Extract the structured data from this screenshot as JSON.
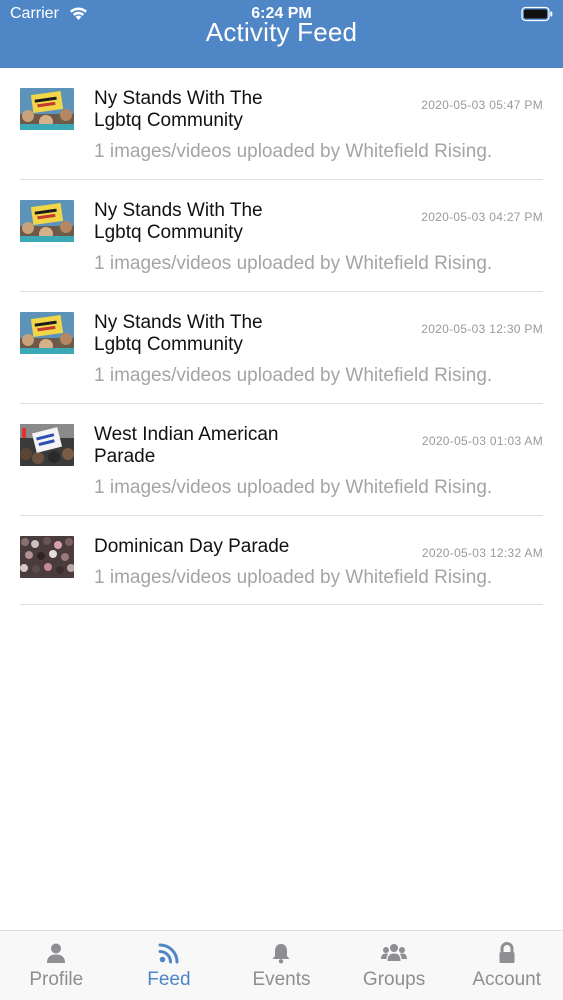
{
  "status_bar": {
    "carrier": "Carrier",
    "time": "6:24 PM"
  },
  "header": {
    "title": "Activity Feed",
    "background_color": "#4f86c6"
  },
  "feed": {
    "items": [
      {
        "title": "Ny Stands With The Lgbtq Community",
        "timestamp": "2020-05-03 05:47 PM",
        "subtitle": "1 images/videos uploaded by Whitefield Rising.",
        "thumbnail": "protest-sign-image"
      },
      {
        "title": "Ny Stands With The Lgbtq Community",
        "timestamp": "2020-05-03 04:27 PM",
        "subtitle": "1 images/videos uploaded by Whitefield Rising.",
        "thumbnail": "protest-sign-image"
      },
      {
        "title": "Ny Stands With The Lgbtq Community",
        "timestamp": "2020-05-03 12:30 PM",
        "subtitle": "1 images/videos uploaded by Whitefield Rising.",
        "thumbnail": "protest-sign-image"
      },
      {
        "title": "West Indian American Parade",
        "timestamp": "2020-05-03 01:03 AM",
        "subtitle": "1 images/videos uploaded by Whitefield Rising.",
        "thumbnail": "parade-sign-image"
      },
      {
        "title": "Dominican Day Parade",
        "timestamp": "2020-05-03 12:32 AM",
        "subtitle": "1 images/videos uploaded by Whitefield Rising.",
        "thumbnail": "crowd-image"
      }
    ]
  },
  "tab_bar": {
    "active_color": "#4f86c6",
    "inactive_color": "#8e8e93",
    "tabs": [
      {
        "label": "Profile",
        "icon": "person-icon",
        "active": false
      },
      {
        "label": "Feed",
        "icon": "rss-icon",
        "active": true
      },
      {
        "label": "Events",
        "icon": "bell-icon",
        "active": false
      },
      {
        "label": "Groups",
        "icon": "users-icon",
        "active": false
      },
      {
        "label": "Account",
        "icon": "lock-icon",
        "active": false
      }
    ]
  }
}
